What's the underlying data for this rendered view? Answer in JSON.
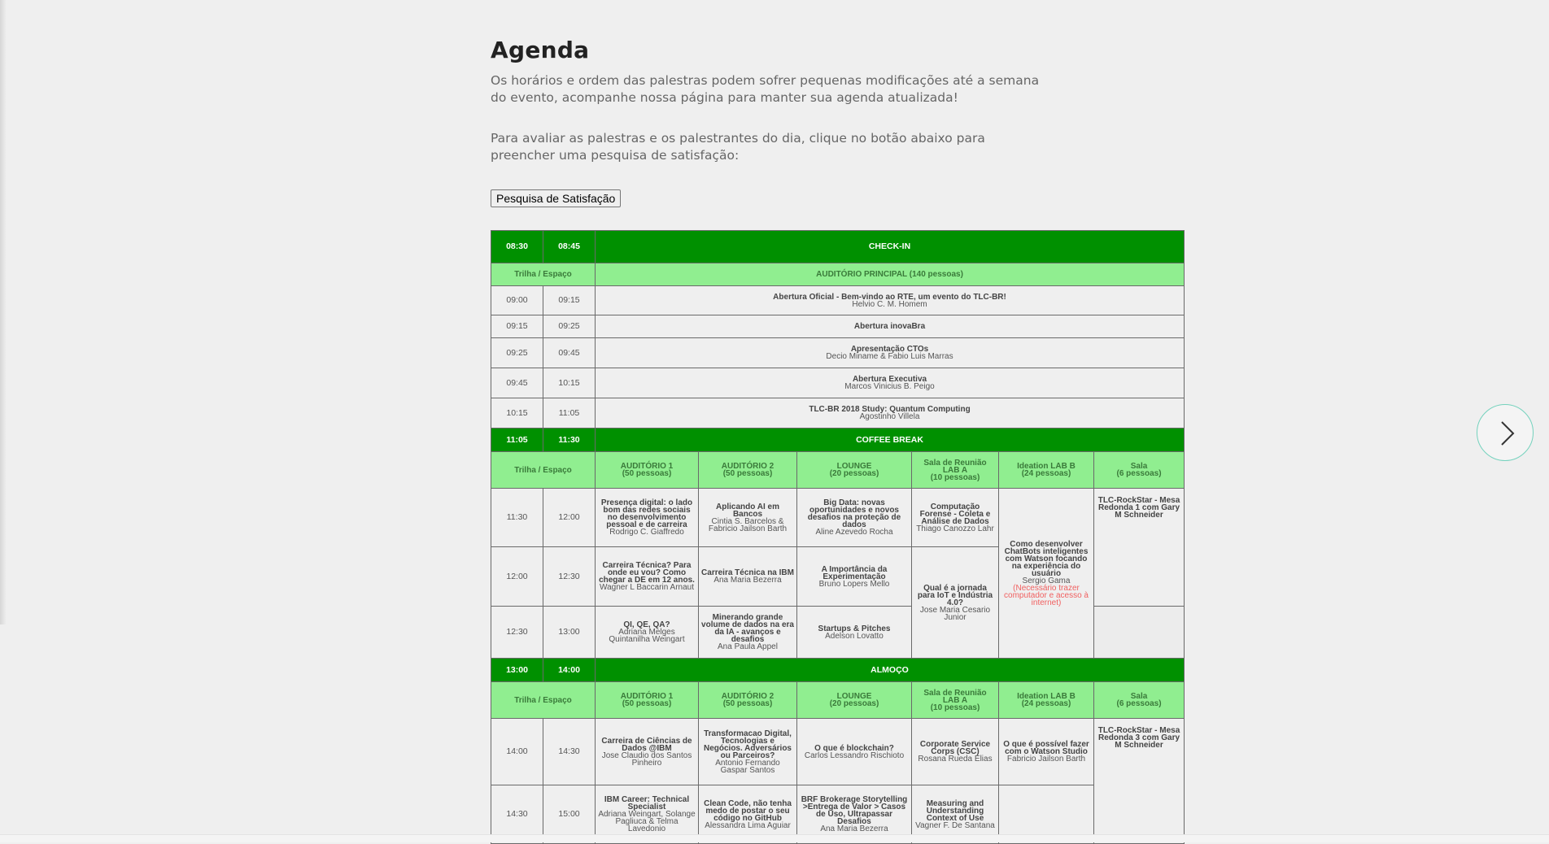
{
  "page": {
    "title": "Agenda",
    "intro1": "Os horários e ordem das palestras podem sofrer pequenas modificações até a semana do evento, acompanhe nossa página para manter sua agenda atualizada!",
    "intro2": "Para avaliar as palestras e os palestrantes do dia, clique no botão abaixo para preencher uma pesquisa de satisfação:",
    "survey_button": "Pesquisa de Satisfação",
    "next_icon": "chevron-right-icon"
  },
  "colors": {
    "header_green": "#009000",
    "subheader_green": "#90ee90",
    "warning_red": "#f06060",
    "next_button_border": "#74d2bd"
  },
  "agenda": {
    "checkin": {
      "start": "08:30",
      "end": "08:45",
      "label": "CHECK-IN"
    },
    "track_label": "Trilha / Espaço",
    "main_room": "AUDITÓRIO PRINCIPAL (140 pessoas)",
    "opening": [
      {
        "start": "09:00",
        "end": "09:15",
        "title": "Abertura Oficial - Bem-vindo ao RTE, um evento do TLC-BR!",
        "speaker": "Helvio C. M. Homem"
      },
      {
        "start": "09:15",
        "end": "09:25",
        "title": "Abertura inovaBra",
        "speaker": ""
      },
      {
        "start": "09:25",
        "end": "09:45",
        "title": "Apresentação CTOs",
        "speaker": "Decio Miname & Fabio Luis Marras"
      },
      {
        "start": "09:45",
        "end": "10:15",
        "title": "Abertura Executiva",
        "speaker": "Marcos Vinicius B. Peigo"
      },
      {
        "start": "10:15",
        "end": "11:05",
        "title": "TLC-BR 2018 Study: Quantum Computing",
        "speaker": "Agostinho Villela"
      }
    ],
    "coffee": {
      "start": "11:05",
      "end": "11:30",
      "label": "COFFEE BREAK"
    },
    "rooms_morning": [
      {
        "name": "AUDITÓRIO 1",
        "cap": "(50 pessoas)"
      },
      {
        "name": "AUDITÓRIO 2",
        "cap": "(50 pessoas)"
      },
      {
        "name": "LOUNGE",
        "cap": "(20 pessoas)"
      },
      {
        "name": "Sala de Reunião LAB A",
        "cap": "(10 pessoas)"
      },
      {
        "name": "Ideation LAB B",
        "cap": "(24 pessoas)"
      },
      {
        "name": "Sala",
        "cap": "(6 pessoas)"
      }
    ],
    "m1": {
      "start": "11:30",
      "end": "12:00",
      "a1": {
        "title": "Presença digital: o lado bom das redes sociais no desenvolvimento pessoal e de carreira",
        "speaker": "Rodrigo C. Giaffredo"
      },
      "a2": {
        "title": "Aplicando AI em Bancos",
        "speaker": "Cintia S. Barcelos & Fabricio Jailson Barth"
      },
      "lounge": {
        "title": "Big Data: novas oportunidades e novos desafios na proteção de dados",
        "speaker": "Aline Azevedo Rocha"
      },
      "laba": {
        "title": "Computação Forense - Coleta e Análise de Dados",
        "speaker": "Thiago Canozzo Lahr"
      },
      "labb": {
        "title": "Como desenvolver ChatBots inteligentes com Watson focando na experiência do usuário",
        "speaker": "Sergio Gama",
        "note": "(Necessário trazer computador e acesso à internet)"
      },
      "sala": {
        "title": "TLC-RockStar - Mesa Redonda 1 com Gary M Schneider"
      }
    },
    "m2": {
      "start": "12:00",
      "end": "12:30",
      "a1": {
        "title": "Carreira Técnica? Para onde eu vou? Como chegar a DE em 12 anos.",
        "speaker": "Wagner L Baccarin Arnaut"
      },
      "a2": {
        "title": "Carreira Técnica na IBM",
        "speaker": "Ana Maria Bezerra"
      },
      "lounge": {
        "title": "A Importância da Experimentação",
        "speaker": "Bruno Lopers Mello"
      },
      "laba": {
        "title": "Qual é a jornada para IoT e Indústria 4.0?",
        "speaker": "Jose Maria Cesario Junior"
      }
    },
    "m3": {
      "start": "12:30",
      "end": "13:00",
      "a1": {
        "title": "QI, QE, QA?",
        "speaker": "Adriana Melges Quintanilha Weingart"
      },
      "a2": {
        "title": "Minerando grande volume de dados na era da IA - avanços e desafios",
        "speaker": "Ana Paula Appel"
      },
      "lounge": {
        "title": "Startups & Pitches",
        "speaker": "Adelson Lovatto"
      }
    },
    "lunch": {
      "start": "13:00",
      "end": "14:00",
      "label": "ALMOÇO"
    },
    "rooms_afternoon": [
      {
        "name": "AUDITÓRIO 1",
        "cap": "(50 pessoas)"
      },
      {
        "name": "AUDITÓRIO 2",
        "cap": "(50 pessoas)"
      },
      {
        "name": "LOUNGE",
        "cap": "(20 pessoas)"
      },
      {
        "name": "Sala de Reunião LAB A",
        "cap": "(10 pessoas)"
      },
      {
        "name": "Ideation LAB B",
        "cap": "(24 pessoas)"
      },
      {
        "name": "Sala",
        "cap": "(6 pessoas)"
      }
    ],
    "a1row": {
      "start": "14:00",
      "end": "14:30",
      "a1": {
        "title": "Carreira de Ciências de Dados @IBM",
        "speaker": "Jose Claudio dos Santos Pinheiro"
      },
      "a2": {
        "title": "Transformacao Digital, Tecnologias e Negócios. Adversários ou Parceiros?",
        "speaker": "Antonio Fernando Gaspar Santos"
      },
      "lounge": {
        "title": "O que é blockchain?",
        "speaker": "Carlos Lessandro Rischioto"
      },
      "laba": {
        "title": "Corporate Service Corps (CSC)",
        "speaker": "Rosana Rueda Elias"
      },
      "labb": {
        "title": "O que é possível fazer com o Watson Studio",
        "speaker": "Fabricio Jailson Barth"
      },
      "sala": {
        "title": "TLC-RockStar - Mesa Redonda 3 com Gary M Schneider"
      }
    },
    "a2row": {
      "start": "14:30",
      "end": "15:00",
      "a1": {
        "title": "IBM Career: Technical Specialist",
        "speaker": "Adriana Weingart, Solange Pagliuca & Telma Lavedonio"
      },
      "a2": {
        "title": "Clean Code, não tenha medo de postar o seu código no GitHub",
        "speaker": "Alessandra Lima Aguiar"
      },
      "lounge": {
        "title": "BRF Brokerage Storytelling >Entrega de Valor > Casos de Uso, Ultrapassar Desafios",
        "speaker": "Ana Maria Bezerra"
      },
      "laba": {
        "title": "Measuring and Understanding Context of Use",
        "speaker": "Vagner F. De Santana"
      }
    }
  }
}
